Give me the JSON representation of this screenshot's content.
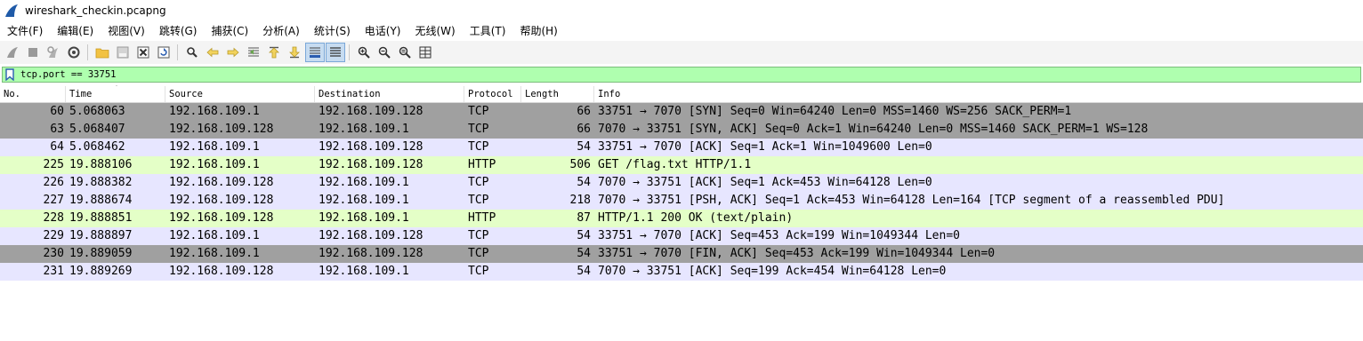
{
  "window": {
    "title": "wireshark_checkin.pcapng"
  },
  "menu": [
    "文件(F)",
    "编辑(E)",
    "视图(V)",
    "跳转(G)",
    "捕获(C)",
    "分析(A)",
    "统计(S)",
    "电话(Y)",
    "无线(W)",
    "工具(T)",
    "帮助(H)"
  ],
  "toolbar": {
    "icons": [
      "shark-fin-start-icon",
      "stop-icon",
      "restart-icon",
      "options-gear-icon",
      "open-folder-icon",
      "save-file-icon",
      "close-file-icon",
      "reload-icon",
      "find-icon",
      "go-back-icon",
      "go-forward-icon",
      "go-to-packet-icon",
      "first-packet-icon",
      "last-packet-icon",
      "auto-scroll-icon",
      "colorize-icon",
      "zoom-in-icon",
      "zoom-out-icon",
      "zoom-normal-icon",
      "resize-columns-icon"
    ]
  },
  "filter": {
    "value": "tcp.port == 33751"
  },
  "columns": [
    "No.",
    "Time",
    "Source",
    "Destination",
    "Protocol",
    "Length",
    "Info"
  ],
  "colors": {
    "gray_row": "#a0a0a0",
    "tcp_row": "#e7e6ff",
    "http_row": "#e4ffc7",
    "filter_bg": "#afffaf"
  },
  "packets": [
    {
      "no": "60",
      "time": "5.068063",
      "src": "192.168.109.1",
      "dst": "192.168.109.128",
      "proto": "TCP",
      "len": "66",
      "info": "33751 → 7070 [SYN] Seq=0 Win=64240 Len=0 MSS=1460 WS=256 SACK_PERM=1",
      "color": "#a0a0a0"
    },
    {
      "no": "63",
      "time": "5.068407",
      "src": "192.168.109.128",
      "dst": "192.168.109.1",
      "proto": "TCP",
      "len": "66",
      "info": "7070 → 33751 [SYN, ACK] Seq=0 Ack=1 Win=64240 Len=0 MSS=1460 SACK_PERM=1 WS=128",
      "color": "#a0a0a0"
    },
    {
      "no": "64",
      "time": "5.068462",
      "src": "192.168.109.1",
      "dst": "192.168.109.128",
      "proto": "TCP",
      "len": "54",
      "info": "33751 → 7070 [ACK] Seq=1 Ack=1 Win=1049600 Len=0",
      "color": "#e7e6ff"
    },
    {
      "no": "225",
      "time": "19.888106",
      "src": "192.168.109.1",
      "dst": "192.168.109.128",
      "proto": "HTTP",
      "len": "506",
      "info": "GET /flag.txt HTTP/1.1",
      "color": "#e4ffc7"
    },
    {
      "no": "226",
      "time": "19.888382",
      "src": "192.168.109.128",
      "dst": "192.168.109.1",
      "proto": "TCP",
      "len": "54",
      "info": "7070 → 33751 [ACK] Seq=1 Ack=453 Win=64128 Len=0",
      "color": "#e7e6ff"
    },
    {
      "no": "227",
      "time": "19.888674",
      "src": "192.168.109.128",
      "dst": "192.168.109.1",
      "proto": "TCP",
      "len": "218",
      "info": "7070 → 33751 [PSH, ACK] Seq=1 Ack=453 Win=64128 Len=164 [TCP segment of a reassembled PDU]",
      "color": "#e7e6ff"
    },
    {
      "no": "228",
      "time": "19.888851",
      "src": "192.168.109.128",
      "dst": "192.168.109.1",
      "proto": "HTTP",
      "len": "87",
      "info": "HTTP/1.1 200 OK  (text/plain)",
      "color": "#e4ffc7"
    },
    {
      "no": "229",
      "time": "19.888897",
      "src": "192.168.109.1",
      "dst": "192.168.109.128",
      "proto": "TCP",
      "len": "54",
      "info": "33751 → 7070 [ACK] Seq=453 Ack=199 Win=1049344 Len=0",
      "color": "#e7e6ff"
    },
    {
      "no": "230",
      "time": "19.889059",
      "src": "192.168.109.1",
      "dst": "192.168.109.128",
      "proto": "TCP",
      "len": "54",
      "info": "33751 → 7070 [FIN, ACK] Seq=453 Ack=199 Win=1049344 Len=0",
      "color": "#a0a0a0"
    },
    {
      "no": "231",
      "time": "19.889269",
      "src": "192.168.109.128",
      "dst": "192.168.109.1",
      "proto": "TCP",
      "len": "54",
      "info": "7070 → 33751 [ACK] Seq=199 Ack=454 Win=64128 Len=0",
      "color": "#e7e6ff"
    }
  ]
}
